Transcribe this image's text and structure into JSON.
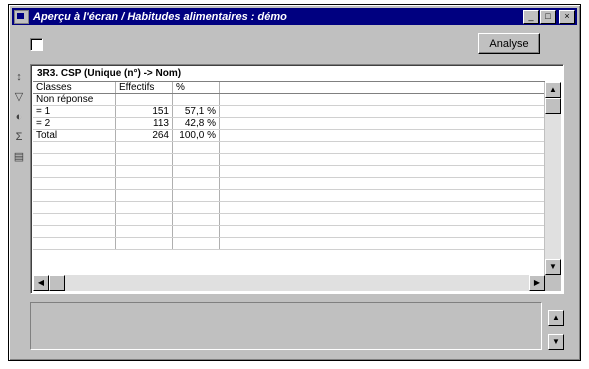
{
  "window": {
    "title": "Aperçu à l'écran / Habitudes alimentaires : démo",
    "min_label": "_",
    "max_label": "□",
    "close_label": "×"
  },
  "toolbar": {
    "exclude_checkbox_label": "",
    "analyse_button": "Analyse",
    "tool_icons": [
      "sort-icon",
      "filter-icon",
      "chart-icon",
      "stats-icon",
      "copy-icon"
    ]
  },
  "grid": {
    "title": "3R3. CSP (Unique (n°) -> Nom)",
    "columns": [
      "Classes",
      "Effectifs",
      "%"
    ],
    "rows": [
      {
        "classe": "Non réponse",
        "effectif": "",
        "pct": ""
      },
      {
        "classe": "= 1",
        "effectif": "151",
        "pct": "57,1 %"
      },
      {
        "classe": "= 2",
        "effectif": "113",
        "pct": "42,8 %"
      },
      {
        "classe": "Total",
        "effectif": "264",
        "pct": "100,0 %"
      }
    ]
  },
  "status": {
    "line1": "",
    "line2": ""
  }
}
